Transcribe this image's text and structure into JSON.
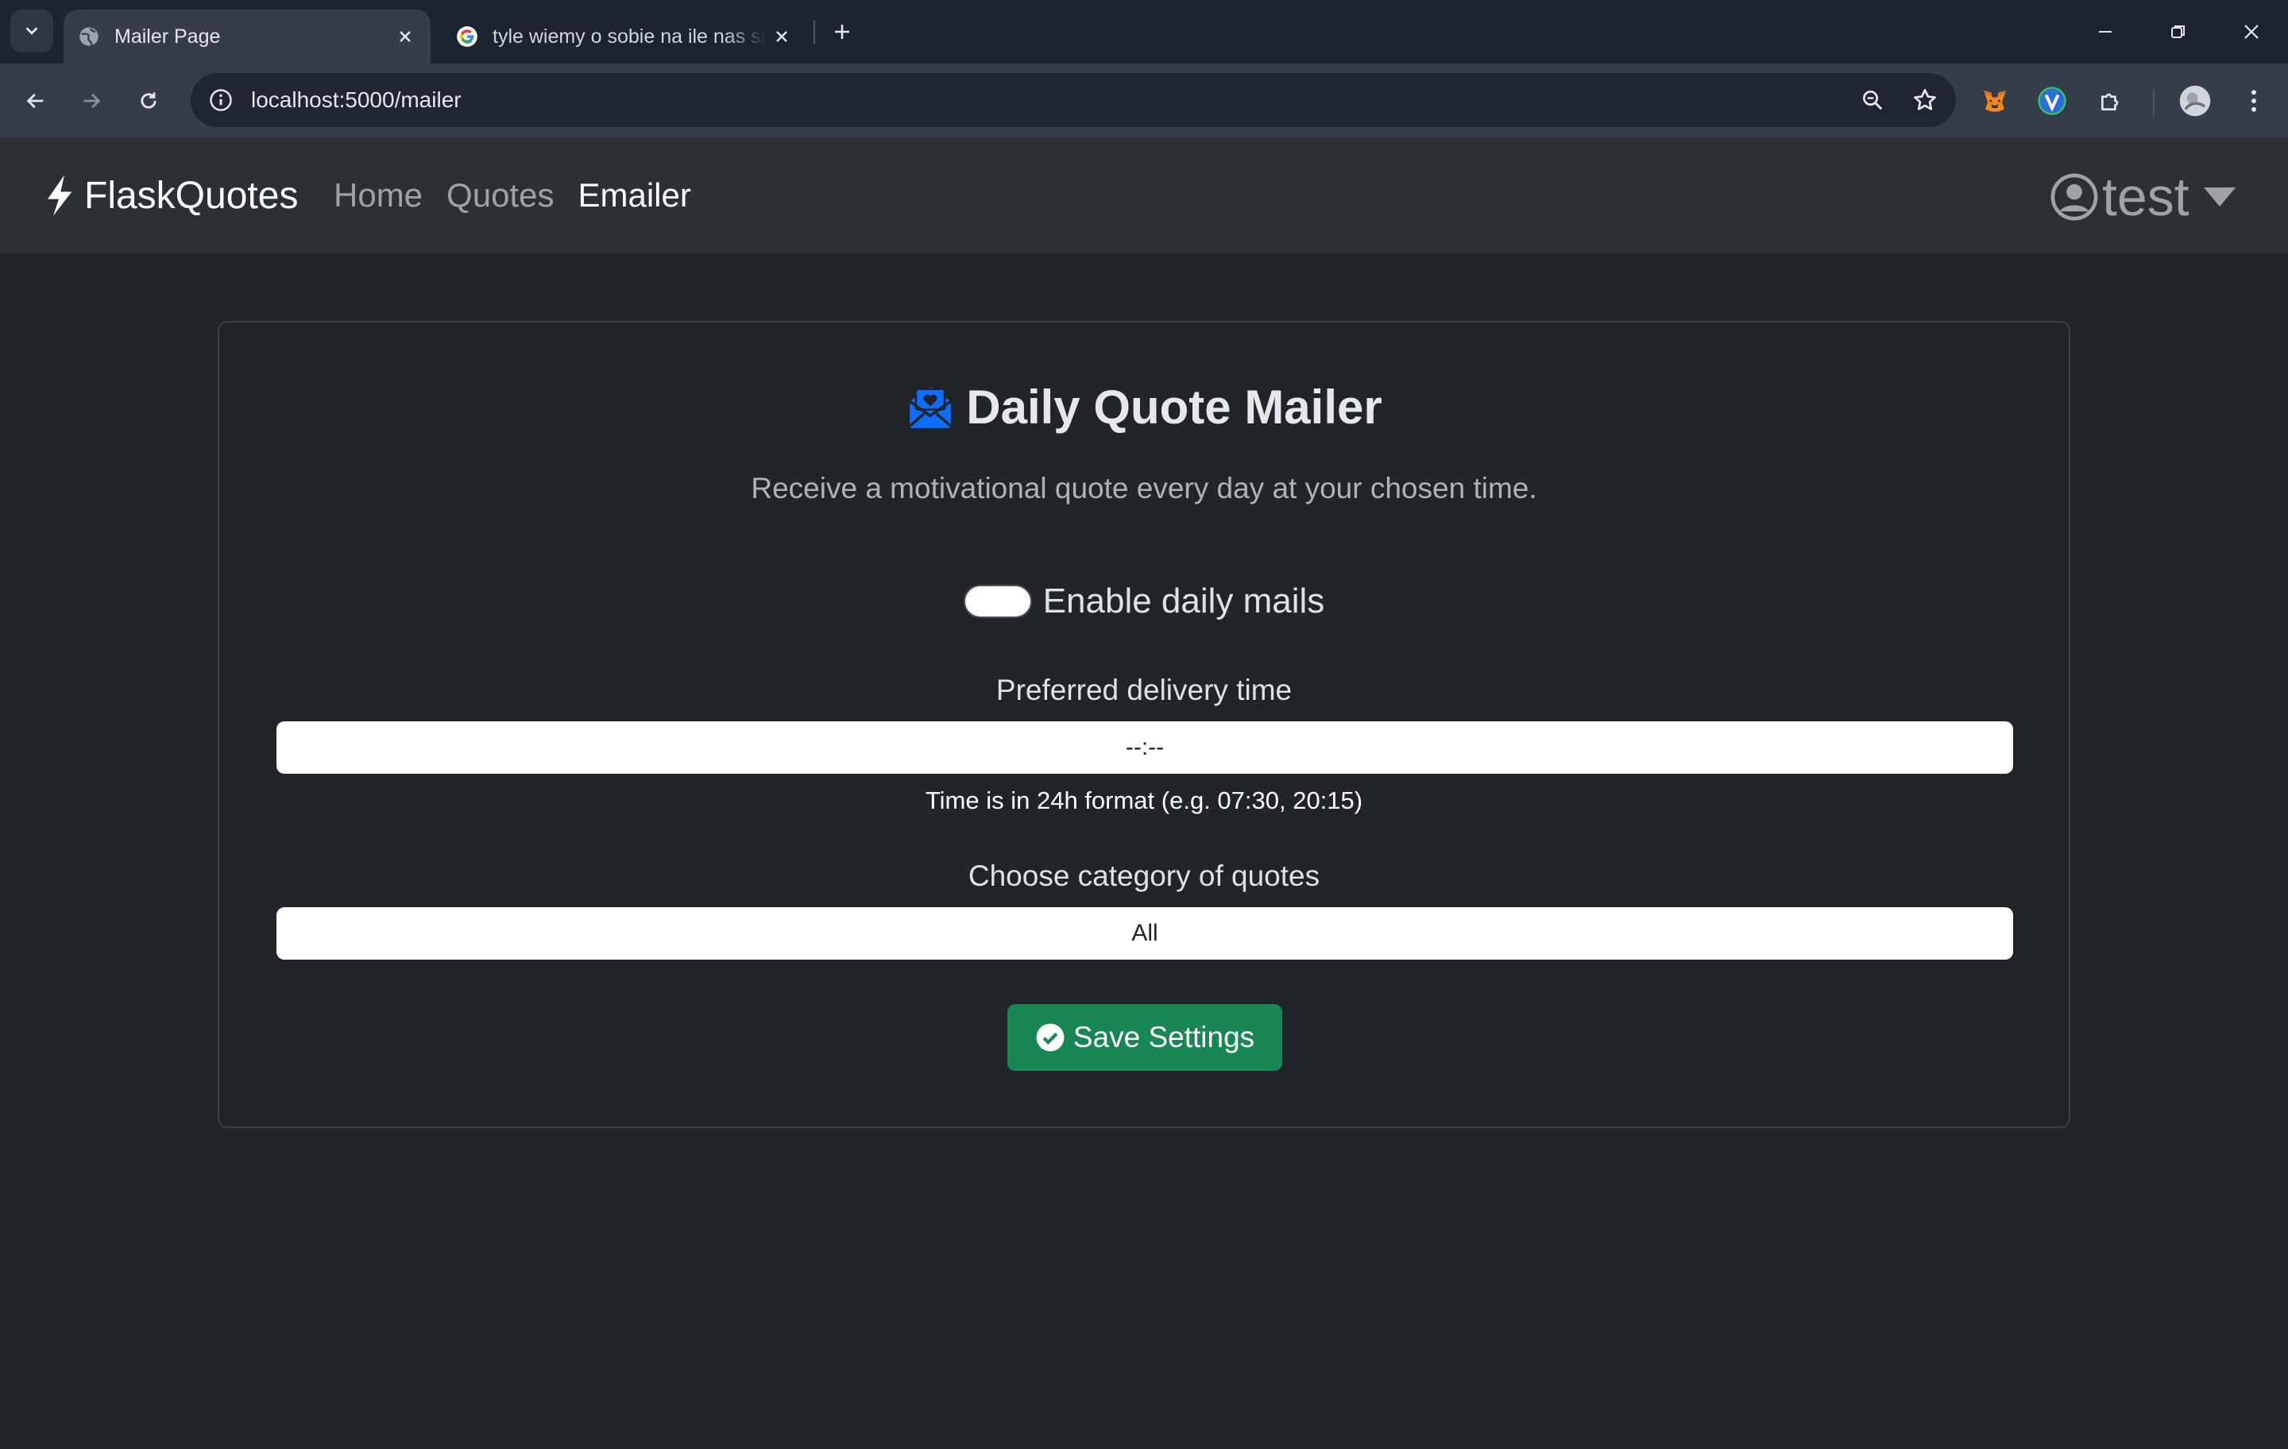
{
  "browser": {
    "tabs": [
      {
        "title": "Mailer Page",
        "favicon": "globe-icon",
        "active": true
      },
      {
        "title": "tyle wiemy o sobie na ile nas sprawdzono",
        "favicon": "google-icon",
        "active": false
      }
    ],
    "url": "localhost:5000/mailer"
  },
  "navbar": {
    "brand": "FlaskQuotes",
    "links": [
      "Home",
      "Quotes",
      "Emailer"
    ],
    "active_link": "Emailer",
    "user": "test"
  },
  "mailer": {
    "title": "Daily Quote Mailer",
    "subtitle": "Receive a motivational quote every day at your chosen time.",
    "toggle_label": "Enable daily mails",
    "time_label": "Preferred delivery time",
    "time_value": "--:--",
    "time_help": "Time is in 24h format (e.g. 07:30, 20:15)",
    "category_label": "Choose category of quotes",
    "category_value": "All",
    "save_label": "Save Settings"
  },
  "colors": {
    "page_bg": "#212529",
    "navbar_bg": "#2b3035",
    "accent_blue": "#0d6efd",
    "success_green": "#198754"
  }
}
